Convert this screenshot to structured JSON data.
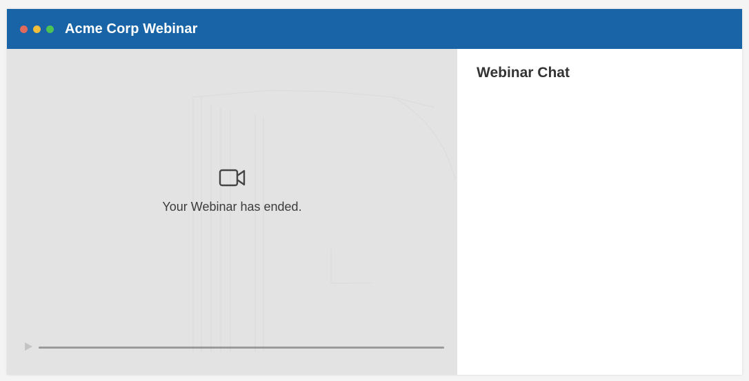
{
  "window": {
    "title": "Acme Corp Webinar",
    "controls": [
      {
        "name": "close",
        "color": "#e26a5d"
      },
      {
        "name": "minimize",
        "color": "#f2bd3a"
      },
      {
        "name": "maximize",
        "color": "#4cc354"
      }
    ],
    "titlebar_color": "#1864a6"
  },
  "video": {
    "status_icon": "video-camera-icon",
    "status_text": "Your Webinar has ended.",
    "progress": 1.0
  },
  "chat": {
    "title": "Webinar Chat"
  }
}
